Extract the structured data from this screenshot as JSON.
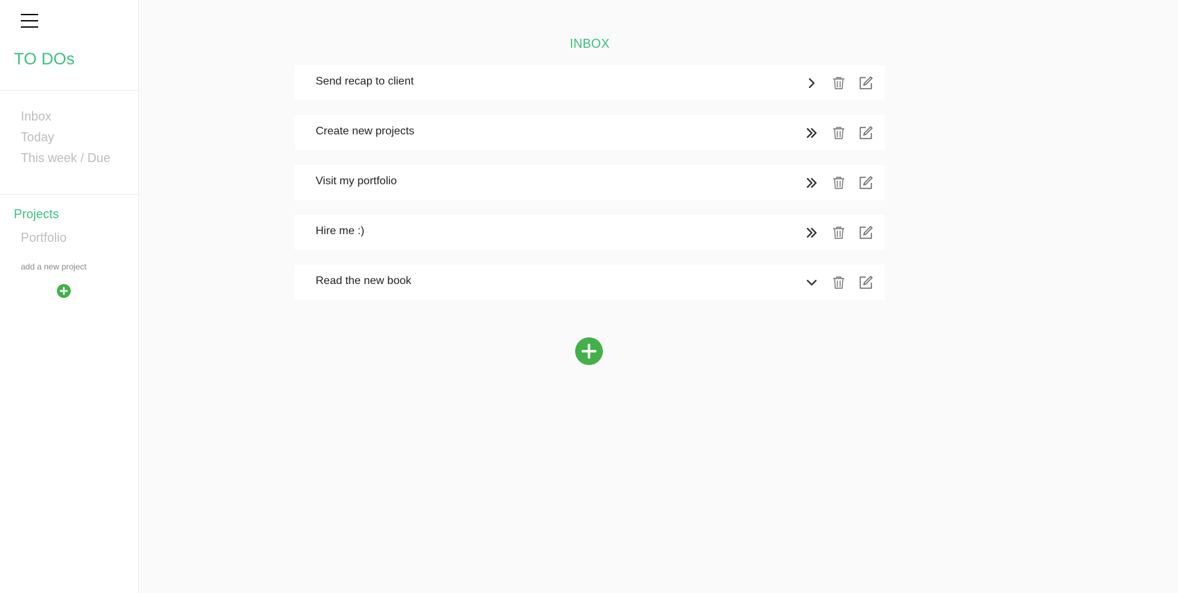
{
  "sidebar": {
    "menu_icon": "hamburger-icon",
    "title": "TO DOs",
    "nav": [
      {
        "label": "Inbox"
      },
      {
        "label": "Today"
      },
      {
        "label": "This week / Due"
      }
    ],
    "projects_heading": "Projects",
    "projects": [
      {
        "label": "Portfolio"
      }
    ],
    "add_project_label": "add a new project",
    "add_project_icon": "plus-circle-icon"
  },
  "main": {
    "title": "INBOX",
    "tasks": [
      {
        "label": "Send recap to client",
        "priority_icon": "chevron-right-icon"
      },
      {
        "label": "Create new projects",
        "priority_icon": "double-chevron-right-icon"
      },
      {
        "label": "Visit my portfolio",
        "priority_icon": "double-chevron-right-icon"
      },
      {
        "label": "Hire me :)",
        "priority_icon": "double-chevron-right-icon"
      },
      {
        "label": "Read the new book",
        "priority_icon": "chevron-down-icon"
      }
    ],
    "add_task_icon": "plus-circle-icon"
  },
  "colors": {
    "accent": "#3dbf7e",
    "add_button": "#43b049",
    "muted_text": "#bdbdbd",
    "background": "#fafafa"
  }
}
